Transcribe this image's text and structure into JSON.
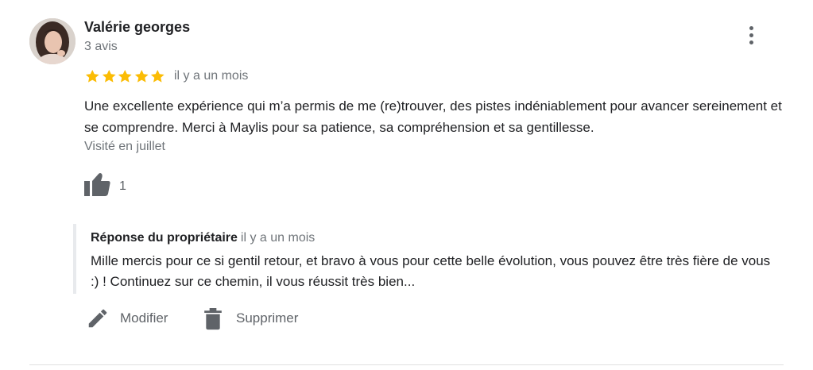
{
  "review": {
    "author": {
      "name": "Valérie georges",
      "review_count": "3 avis"
    },
    "rating": 5,
    "rating_max": 5,
    "date": "il y a un mois",
    "text": "Une excellente expérience qui m’a permis de me (re)trouver, des pistes indéniablement pour avancer sereinement et se comprendre. Merci à Maylis pour sa patience, sa compréhension et sa gentillesse.",
    "visited": "Visité en juillet",
    "likes": "1"
  },
  "owner_reply": {
    "label": "Réponse du propriétaire",
    "date": "il y a un mois",
    "text": "Mille mercis pour ce si gentil retour, et bravo à vous pour cette belle évolution, vous pouvez être très fière de vous :) ! Continuez sur ce chemin, il vous réussit très bien..."
  },
  "actions": {
    "edit_label": "Modifier",
    "delete_label": "Supprimer"
  },
  "icons": {
    "more": "more-vert-icon",
    "star": "star-icon",
    "like": "thumb-up-icon",
    "edit": "pencil-icon",
    "delete": "trash-icon"
  },
  "colors": {
    "star": "#fbbc04",
    "text": "#202124",
    "secondary_text": "#70757a",
    "icon": "#5f6368",
    "reply_border": "#e8eaed",
    "divider": "#e0e0e0"
  }
}
